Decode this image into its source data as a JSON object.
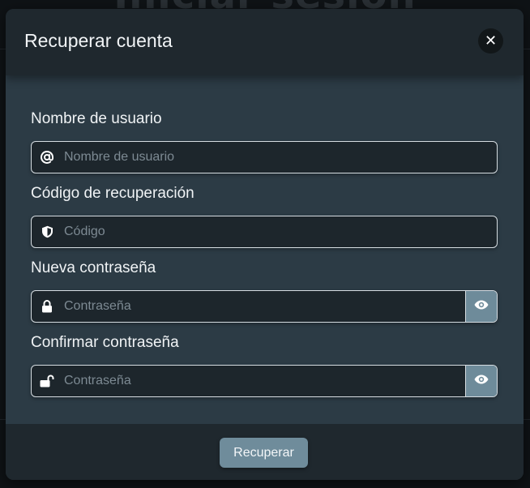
{
  "background": {
    "title": "Iniciar sesión"
  },
  "modal": {
    "title": "Recuperar cuenta",
    "close_icon": "close-icon"
  },
  "fields": {
    "username": {
      "label": "Nombre de usuario",
      "placeholder": "Nombre de usuario",
      "icon": "at-icon"
    },
    "recovery_code": {
      "label": "Código de recuperación",
      "placeholder": "Código",
      "icon": "shield-icon"
    },
    "new_password": {
      "label": "Nueva contraseña",
      "placeholder": "Contraseña",
      "icon": "lock-icon",
      "toggle_icon": "eye-icon"
    },
    "confirm_password": {
      "label": "Confirmar contraseña",
      "placeholder": "Contraseña",
      "icon": "unlock-icon",
      "toggle_icon": "eye-icon"
    }
  },
  "footer": {
    "submit_label": "Recuperar"
  },
  "colors": {
    "modal_bg": "#2c3b45",
    "header_bg": "#1f282e",
    "input_bg": "#1d262c",
    "accent_button": "#6f8c9b"
  }
}
